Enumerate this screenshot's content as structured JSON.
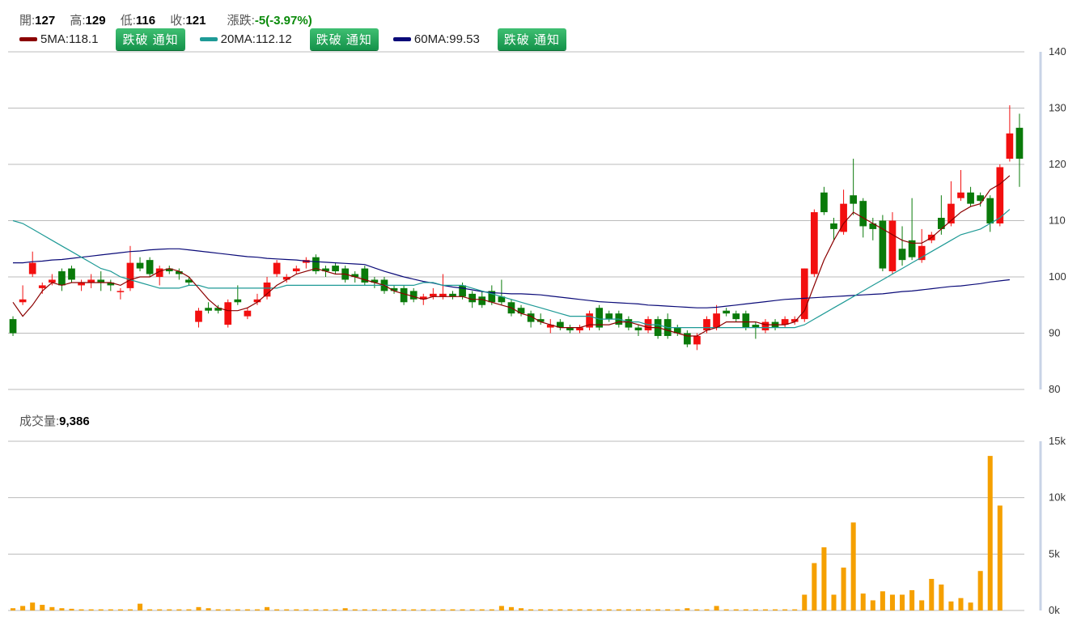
{
  "header": {
    "open_label": "開:",
    "open_value": "127",
    "high_label": "高:",
    "high_value": "129",
    "low_label": "低:",
    "low_value": "116",
    "close_label": "收:",
    "close_value": "121",
    "change_label": "漲跌:",
    "change_value": "-5(-3.97%)"
  },
  "ma_legend": [
    {
      "label": "5MA:118.1",
      "color": "#8b0000",
      "button": "跌破 通知"
    },
    {
      "label": "20MA:112.12",
      "color": "#1e9a96",
      "button": "跌破 通知"
    },
    {
      "label": "60MA:99.53",
      "color": "#0a0a78",
      "button": "跌破 通知"
    }
  ],
  "volume_header": {
    "label": "成交量:",
    "value": "9,386"
  },
  "colors": {
    "up": "#f20f0f",
    "down": "#0a7a0a",
    "volume": "#f5a000",
    "ma5": "#8b0000",
    "ma20": "#1e9a96",
    "ma60": "#0a0a78",
    "grid": "#bbbbbb"
  },
  "chart_data": [
    {
      "type": "candlestick",
      "y_ticks": [
        "80",
        "90",
        "100",
        "110",
        "120",
        "130",
        "140"
      ],
      "ylim": [
        80,
        140
      ],
      "candles": [
        [
          92.5,
          90.0,
          93.0,
          89.5
        ],
        [
          95.5,
          96.0,
          98.5,
          95.0
        ],
        [
          100.5,
          102.5,
          104.5,
          100.0
        ],
        [
          98.0,
          98.5,
          99.0,
          97.0
        ],
        [
          99.0,
          99.5,
          100.5,
          98.5
        ],
        [
          101.0,
          98.5,
          101.5,
          97.5
        ],
        [
          101.5,
          99.5,
          102.0,
          99.0
        ],
        [
          98.5,
          99.0,
          99.5,
          97.5
        ],
        [
          99.0,
          99.5,
          100.5,
          98.0
        ],
        [
          99.5,
          99.0,
          101.0,
          97.5
        ],
        [
          99.0,
          98.5,
          99.5,
          97.5
        ],
        [
          97.5,
          97.5,
          98.0,
          96.0
        ],
        [
          98.0,
          102.5,
          105.5,
          97.5
        ],
        [
          102.5,
          101.5,
          103.5,
          101.0
        ],
        [
          103.0,
          100.5,
          103.5,
          100.0
        ],
        [
          100.0,
          101.5,
          102.0,
          98.5
        ],
        [
          101.5,
          101.0,
          102.0,
          100.5
        ],
        [
          101.0,
          100.5,
          101.5,
          99.5
        ],
        [
          99.5,
          99.0,
          100.0,
          98.5
        ],
        [
          92.0,
          94.0,
          94.5,
          91.0
        ],
        [
          94.5,
          94.0,
          95.5,
          93.5
        ],
        [
          94.5,
          94.0,
          95.0,
          93.5
        ],
        [
          91.5,
          95.5,
          96.0,
          91.0
        ],
        [
          96.0,
          95.5,
          98.5,
          95.0
        ],
        [
          93.0,
          94.0,
          94.5,
          92.5
        ],
        [
          95.5,
          96.0,
          97.0,
          95.0
        ],
        [
          96.5,
          99.0,
          100.0,
          96.0
        ],
        [
          100.5,
          102.5,
          103.0,
          100.0
        ],
        [
          99.5,
          100.0,
          100.5,
          99.0
        ],
        [
          101.0,
          101.5,
          102.0,
          100.5
        ],
        [
          102.5,
          103.0,
          103.5,
          101.5
        ],
        [
          103.5,
          101.0,
          104.0,
          100.5
        ],
        [
          101.5,
          101.0,
          102.0,
          100.0
        ],
        [
          102.0,
          101.0,
          102.5,
          100.5
        ],
        [
          101.5,
          99.5,
          102.0,
          99.0
        ],
        [
          100.5,
          100.0,
          101.0,
          99.0
        ],
        [
          101.5,
          99.0,
          102.0,
          98.5
        ],
        [
          99.5,
          99.0,
          100.0,
          98.0
        ],
        [
          99.5,
          97.5,
          100.0,
          97.0
        ],
        [
          98.0,
          97.5,
          98.5,
          97.0
        ],
        [
          98.0,
          95.5,
          98.5,
          95.0
        ],
        [
          97.5,
          96.0,
          98.0,
          95.5
        ],
        [
          96.0,
          96.5,
          97.0,
          95.0
        ],
        [
          96.5,
          97.0,
          98.0,
          96.0
        ],
        [
          96.5,
          97.0,
          100.5,
          96.0
        ],
        [
          97.0,
          96.5,
          97.5,
          96.0
        ],
        [
          98.5,
          96.5,
          99.0,
          96.0
        ],
        [
          97.0,
          95.5,
          97.5,
          94.5
        ],
        [
          96.5,
          95.0,
          97.5,
          94.5
        ],
        [
          97.5,
          95.5,
          98.5,
          95.0
        ],
        [
          96.5,
          95.5,
          99.5,
          95.0
        ],
        [
          95.5,
          93.5,
          96.0,
          93.0
        ],
        [
          94.5,
          93.5,
          95.0,
          93.0
        ],
        [
          93.5,
          92.0,
          94.0,
          91.0
        ],
        [
          92.5,
          92.0,
          93.5,
          91.5
        ],
        [
          91.0,
          91.5,
          92.5,
          90.0
        ],
        [
          92.0,
          91.0,
          92.5,
          90.5
        ],
        [
          91.0,
          90.5,
          91.5,
          90.0
        ],
        [
          90.5,
          91.0,
          91.5,
          90.0
        ],
        [
          91.0,
          93.5,
          94.0,
          90.5
        ],
        [
          94.5,
          91.0,
          95.0,
          90.5
        ],
        [
          93.5,
          92.5,
          94.0,
          92.0
        ],
        [
          93.5,
          91.5,
          94.0,
          91.0
        ],
        [
          92.5,
          91.0,
          93.0,
          90.5
        ],
        [
          91.0,
          90.5,
          91.5,
          89.5
        ],
        [
          90.5,
          92.5,
          93.0,
          90.0
        ],
        [
          92.5,
          89.5,
          93.0,
          89.0
        ],
        [
          92.5,
          89.5,
          93.5,
          89.0
        ],
        [
          91.0,
          90.0,
          91.5,
          89.5
        ],
        [
          90.0,
          88.0,
          90.5,
          87.5
        ],
        [
          88.0,
          89.5,
          90.0,
          87.0
        ],
        [
          90.5,
          92.5,
          93.0,
          90.0
        ],
        [
          91.0,
          93.5,
          95.0,
          90.5
        ],
        [
          94.0,
          93.5,
          94.5,
          93.0
        ],
        [
          93.5,
          92.5,
          94.0,
          92.0
        ],
        [
          93.5,
          91.0,
          94.0,
          90.5
        ],
        [
          91.5,
          91.0,
          92.0,
          89.0
        ],
        [
          90.5,
          92.0,
          92.5,
          90.0
        ],
        [
          92.0,
          91.0,
          92.5,
          90.5
        ],
        [
          91.5,
          92.5,
          93.0,
          91.0
        ],
        [
          92.0,
          92.5,
          93.0,
          91.5
        ],
        [
          92.5,
          101.5,
          101.5,
          92.0
        ],
        [
          100.5,
          111.5,
          112.0,
          100.0
        ],
        [
          115.0,
          111.5,
          116.0,
          111.0
        ],
        [
          109.5,
          108.5,
          110.5,
          106.5
        ],
        [
          108.0,
          113.0,
          115.5,
          107.5
        ],
        [
          114.5,
          113.0,
          121.0,
          111.0
        ],
        [
          113.5,
          109.0,
          114.0,
          107.0
        ],
        [
          109.5,
          108.5,
          110.5,
          106.5
        ],
        [
          110.0,
          101.5,
          111.0,
          101.0
        ],
        [
          101.0,
          110.0,
          111.5,
          100.5
        ],
        [
          105.0,
          103.0,
          109.0,
          102.0
        ],
        [
          106.5,
          103.5,
          114.0,
          103.0
        ],
        [
          103.0,
          105.5,
          108.5,
          102.5
        ],
        [
          106.5,
          107.5,
          108.0,
          106.0
        ],
        [
          110.5,
          108.5,
          114.5,
          107.5
        ],
        [
          109.5,
          113.0,
          117.0,
          109.0
        ],
        [
          114.0,
          115.0,
          119.0,
          113.5
        ],
        [
          115.0,
          113.0,
          116.0,
          112.5
        ],
        [
          114.5,
          113.5,
          115.0,
          112.5
        ],
        [
          114.0,
          109.5,
          114.5,
          108.0
        ],
        [
          109.5,
          119.5,
          120.0,
          109.0
        ],
        [
          121.0,
          125.5,
          130.5,
          120.5
        ],
        [
          126.5,
          121.0,
          129.0,
          116.0
        ]
      ],
      "ma5": [
        95.5,
        93.0,
        95.0,
        97.5,
        99.0,
        98.5,
        99.0,
        99.0,
        99.0,
        99.0,
        99.0,
        98.5,
        99.5,
        100.0,
        100.0,
        101.0,
        101.5,
        101.0,
        100.0,
        98.0,
        96.0,
        94.5,
        94.0,
        94.0,
        94.5,
        95.5,
        97.0,
        98.5,
        99.5,
        100.5,
        101.0,
        101.5,
        101.0,
        100.5,
        100.5,
        100.0,
        99.5,
        99.0,
        98.5,
        97.5,
        97.0,
        96.5,
        96.0,
        96.5,
        96.5,
        96.5,
        96.5,
        96.0,
        96.0,
        95.5,
        95.0,
        94.5,
        93.5,
        93.0,
        92.0,
        91.5,
        91.0,
        91.0,
        91.0,
        91.5,
        91.5,
        91.5,
        92.0,
        92.0,
        91.5,
        91.0,
        91.0,
        90.5,
        90.0,
        89.5,
        89.5,
        90.5,
        91.0,
        92.0,
        92.0,
        92.0,
        92.0,
        91.5,
        91.5,
        91.5,
        92.0,
        94.0,
        98.5,
        103.0,
        106.5,
        109.5,
        111.5,
        110.5,
        109.5,
        108.5,
        107.5,
        106.5,
        106.0,
        106.0,
        107.0,
        108.5,
        110.0,
        111.5,
        112.5,
        113.0,
        115.5,
        116.5,
        118.0
      ],
      "ma20": [
        110.0,
        109.5,
        108.5,
        107.5,
        106.5,
        105.5,
        104.5,
        103.5,
        102.5,
        101.5,
        101.0,
        100.0,
        99.5,
        99.0,
        98.5,
        98.0,
        98.0,
        98.0,
        98.5,
        98.5,
        98.0,
        98.0,
        98.0,
        98.0,
        98.0,
        98.0,
        98.0,
        98.0,
        98.5,
        98.5,
        98.5,
        98.5,
        98.5,
        98.5,
        98.5,
        98.5,
        98.5,
        98.5,
        98.5,
        98.5,
        98.5,
        98.5,
        99.0,
        99.0,
        98.5,
        98.5,
        98.5,
        98.0,
        97.5,
        97.0,
        96.5,
        96.0,
        95.5,
        95.0,
        94.5,
        94.0,
        93.5,
        93.0,
        93.0,
        93.0,
        92.5,
        92.5,
        92.5,
        92.0,
        92.0,
        91.5,
        91.5,
        91.0,
        91.0,
        91.0,
        91.0,
        91.0,
        91.0,
        91.0,
        91.0,
        91.0,
        91.0,
        91.0,
        91.0,
        91.0,
        91.0,
        91.5,
        92.5,
        93.5,
        94.5,
        95.5,
        96.5,
        97.5,
        98.5,
        99.5,
        100.5,
        101.5,
        102.5,
        103.5,
        104.5,
        105.5,
        106.5,
        107.5,
        108.0,
        108.5,
        109.5,
        110.5,
        112.0
      ],
      "ma60": [
        102.5,
        102.5,
        102.7,
        102.8,
        103.0,
        103.1,
        103.3,
        103.5,
        103.7,
        103.9,
        104.1,
        104.3,
        104.5,
        104.6,
        104.8,
        104.9,
        105.0,
        105.0,
        104.8,
        104.6,
        104.4,
        104.2,
        104.0,
        103.8,
        103.6,
        103.5,
        103.3,
        103.2,
        103.1,
        103.0,
        102.8,
        102.7,
        102.6,
        102.5,
        102.4,
        102.3,
        102.2,
        101.6,
        101.0,
        100.5,
        100.0,
        99.6,
        99.2,
        98.9,
        98.5,
        98.2,
        98.0,
        97.7,
        97.4,
        97.2,
        97.1,
        97.0,
        97.0,
        96.9,
        96.8,
        96.6,
        96.4,
        96.2,
        96.0,
        95.8,
        95.6,
        95.5,
        95.4,
        95.3,
        95.2,
        95.0,
        94.9,
        94.8,
        94.7,
        94.6,
        94.5,
        94.5,
        94.6,
        94.8,
        95.0,
        95.2,
        95.4,
        95.6,
        95.8,
        96.0,
        96.1,
        96.2,
        96.3,
        96.4,
        96.5,
        96.6,
        96.7,
        96.8,
        96.9,
        97.0,
        97.2,
        97.4,
        97.5,
        97.7,
        97.9,
        98.1,
        98.3,
        98.4,
        98.6,
        98.8,
        99.1,
        99.3,
        99.5
      ]
    },
    {
      "type": "bar",
      "y_ticks": [
        "0k",
        "5k",
        "10k",
        "15k"
      ],
      "ylim": [
        0,
        15000
      ],
      "values": [
        200,
        400,
        700,
        500,
        300,
        200,
        150,
        100,
        100,
        100,
        100,
        100,
        100,
        600,
        100,
        100,
        100,
        100,
        100,
        300,
        200,
        100,
        100,
        100,
        100,
        100,
        300,
        100,
        100,
        100,
        100,
        100,
        100,
        100,
        200,
        100,
        100,
        100,
        100,
        100,
        100,
        100,
        100,
        100,
        100,
        100,
        100,
        100,
        100,
        100,
        400,
        300,
        200,
        100,
        100,
        100,
        100,
        100,
        100,
        100,
        100,
        100,
        100,
        100,
        100,
        100,
        100,
        100,
        100,
        200,
        100,
        100,
        400,
        100,
        100,
        100,
        100,
        100,
        100,
        100,
        100,
        1400,
        4200,
        5600,
        1400,
        3800,
        7800,
        1500,
        900,
        1700,
        1400,
        1400,
        1800,
        900,
        2800,
        2300,
        800,
        1100,
        700,
        3500,
        13700,
        9300
      ]
    }
  ]
}
